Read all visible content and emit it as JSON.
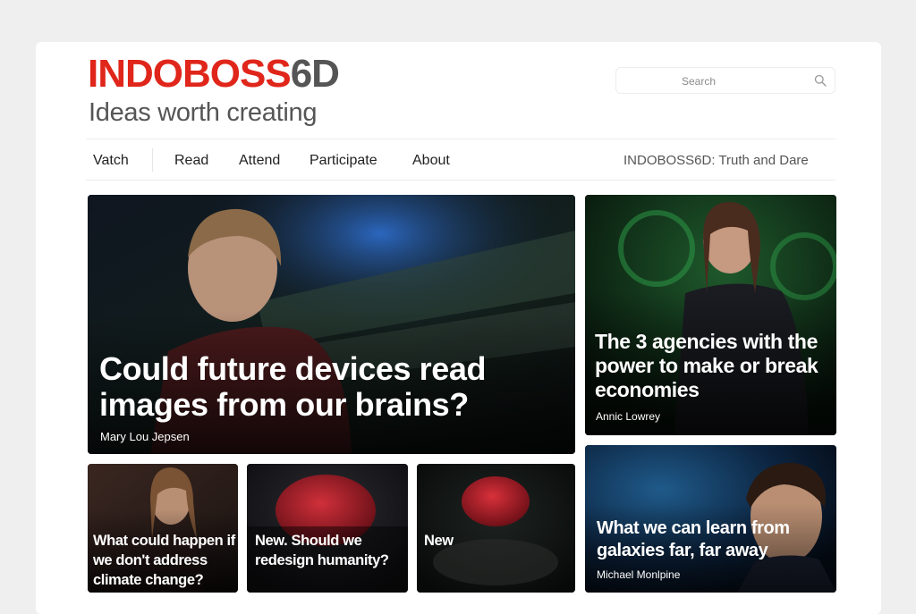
{
  "brand": {
    "logo_red": "INDOBOSS",
    "logo_gray": "6D",
    "tagline": "Ideas worth creating"
  },
  "search": {
    "placeholder": "Search",
    "icon": "search-icon"
  },
  "nav": {
    "items": [
      "Vatch",
      "Read",
      "Attend",
      "Participate",
      "About"
    ],
    "right_link": "INDOBOSS6D: Truth and Dare"
  },
  "colors": {
    "brand_red": "#e0261b",
    "brand_gray": "#555555"
  },
  "cards": {
    "main": {
      "title": "Could future devices read images from our brains?",
      "speaker": "Mary Lou Jepsen"
    },
    "right_top": {
      "title": "The 3 agencies with the power to make or break economies",
      "speaker": "Annic Lowrey"
    },
    "small_1": {
      "title": "What could happen if we don't address climate change?"
    },
    "small_2": {
      "title": "New. Should we redesign humanity?"
    },
    "small_3": {
      "title": "New"
    },
    "right_bot": {
      "title": "What we can learn from galaxies far, far away",
      "speaker": "Michael Monlpine"
    }
  }
}
